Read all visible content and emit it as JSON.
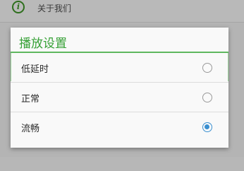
{
  "background": {
    "about_item": {
      "icon": "info-icon",
      "icon_glyph": "i",
      "label": "关于我们"
    }
  },
  "dialog": {
    "title": "播放设置",
    "accent_color": "#35a035",
    "options": [
      {
        "label": "低延时",
        "selected": false
      },
      {
        "label": "正常",
        "selected": false
      },
      {
        "label": "流畅",
        "selected": true
      }
    ],
    "radio_color": "#3a8fd0"
  }
}
